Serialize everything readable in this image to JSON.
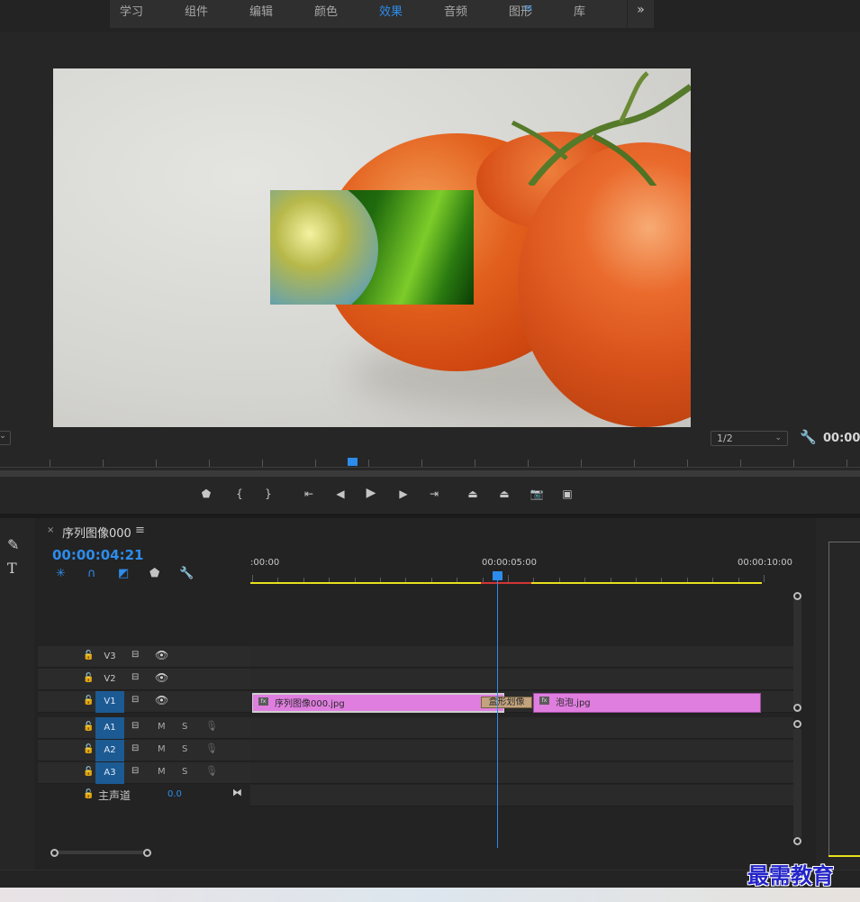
{
  "workspace": {
    "tabs": [
      "学习",
      "组件",
      "编辑",
      "颜色",
      "效果",
      "音频",
      "图形",
      "库"
    ],
    "active_tab": "效果",
    "menu_glyph": "≡",
    "more_glyph": "»"
  },
  "monitor": {
    "resolution": "1/2",
    "fit_glyph": "⌄",
    "timecode": "00:00:"
  },
  "timeline": {
    "sequence_name": "序列图像000",
    "menu_glyph": "≡",
    "close_glyph": "×",
    "timecode": "00:00:04:21",
    "ruler_labels": [
      ":00:00",
      "00:00:05:00",
      "00:00:10:00"
    ],
    "tracks": {
      "video": [
        "V3",
        "V2",
        "V1"
      ],
      "audio": [
        "A1",
        "A2",
        "A3"
      ],
      "mute": "M",
      "solo": "S",
      "master_label": "主声道",
      "master_value": "0.0"
    },
    "clips": {
      "clip1": "序列图像000.jpg",
      "clip2": "泡泡.jpg",
      "transition": "盒形划像",
      "fx_label": "fx"
    }
  },
  "watermark": "最需教育",
  "colors": {
    "accent": "#2d8ceb",
    "clip": "#e07ee0",
    "transition": "#c2a37d",
    "workarea": "#e8e01e"
  },
  "icons": {
    "transport": [
      "marker-icon",
      "mark-in-icon",
      "mark-out-icon",
      "go-to-in-icon",
      "step-back-icon",
      "play-icon",
      "step-forward-icon",
      "go-to-out-icon",
      "lift-icon",
      "extract-icon",
      "export-frame-icon",
      "comparison-view-icon"
    ],
    "timeline_tools": [
      "snap-nest-icon",
      "snap-icon",
      "linked-selection-icon",
      "add-marker-icon",
      "timeline-settings-wrench-icon"
    ]
  }
}
